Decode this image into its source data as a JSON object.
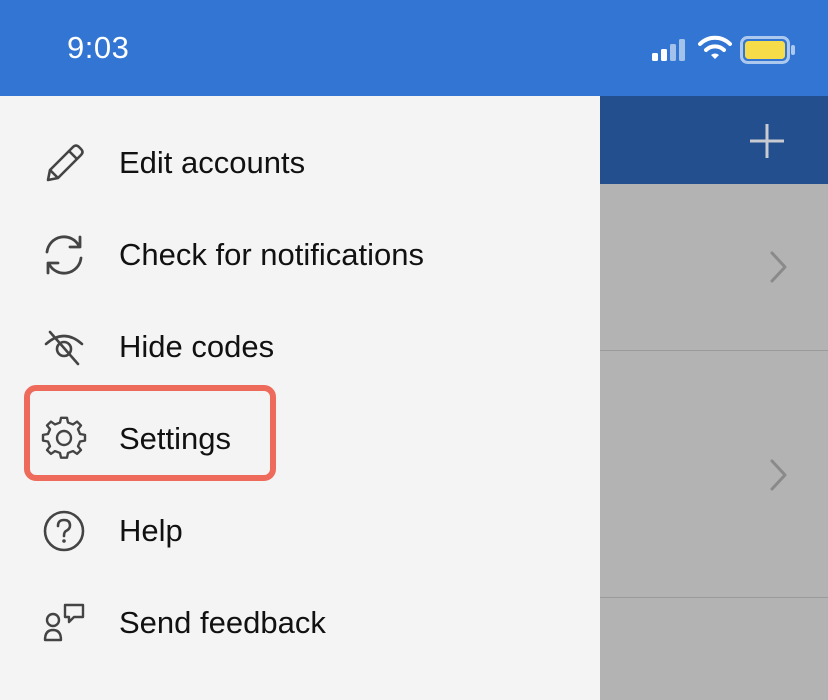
{
  "status_bar": {
    "time": "9:03",
    "icons": [
      "signal-icon",
      "wifi-icon",
      "battery-icon"
    ],
    "color": "#3275d3"
  },
  "background_app": {
    "header_color": "#234f8f",
    "add_icon": "plus-icon",
    "rows": [
      {
        "icon": "chevron-right-icon"
      },
      {
        "icon": "chevron-right-icon"
      }
    ]
  },
  "menu": {
    "items": [
      {
        "label": "Edit accounts",
        "icon": "pencil-icon"
      },
      {
        "label": "Check for notifications",
        "icon": "refresh-icon"
      },
      {
        "label": "Hide codes",
        "icon": "eye-hidden-icon"
      },
      {
        "label": "Settings",
        "icon": "gear-icon",
        "highlighted": true
      },
      {
        "label": "Help",
        "icon": "help-icon"
      },
      {
        "label": "Send feedback",
        "icon": "feedback-icon"
      }
    ],
    "highlight_color": "#ee6a5a"
  }
}
